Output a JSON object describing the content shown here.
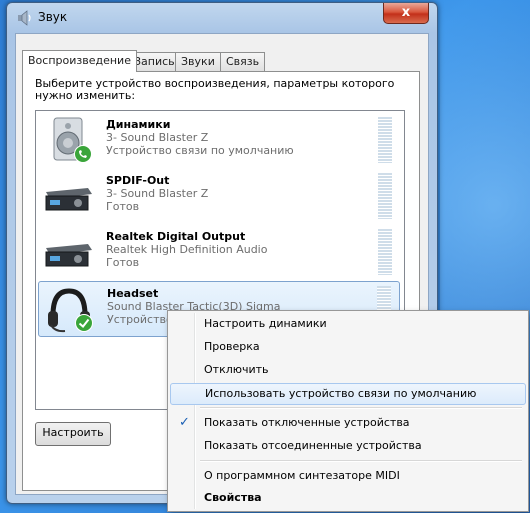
{
  "window": {
    "title": "Звук",
    "close_glyph": "x"
  },
  "tabs": [
    {
      "label": "Воспроизведение",
      "active": true
    },
    {
      "label": "Запись"
    },
    {
      "label": "Звуки"
    },
    {
      "label": "Связь"
    }
  ],
  "instruction": "Выберите устройство воспроизведения, параметры которого нужно изменить:",
  "devices": [
    {
      "name": "Динамики",
      "line2": "3- Sound Blaster Z",
      "line3": "Устройство связи по умолчанию",
      "icon": "speaker-icon",
      "badge": "phone-badge-icon"
    },
    {
      "name": "SPDIF-Out",
      "line2": "3- Sound Blaster Z",
      "line3": "Готов",
      "icon": "receiver-icon"
    },
    {
      "name": "Realtek Digital Output",
      "line2": "Realtek High Definition Audio",
      "line3": "Готов",
      "icon": "receiver-icon"
    },
    {
      "name": "Headset",
      "line2": "Sound Blaster Tactic(3D) Sigma",
      "line3": "Устройство",
      "icon": "headset-icon",
      "badge": "check-badge-icon",
      "selected": true
    }
  ],
  "config_button": "Настроить",
  "context_menu": {
    "items": [
      {
        "label": "Настроить динамики"
      },
      {
        "label": "Проверка"
      },
      {
        "label": "Отключить"
      },
      {
        "label": "Использовать устройство связи по умолчанию",
        "hover": true
      },
      {
        "label": "Показать отключенные устройства",
        "checked": true
      },
      {
        "label": "Показать отсоединенные устройства"
      },
      {
        "label": "О программном синтезаторе MIDI"
      },
      {
        "label": "Свойства",
        "bold": true
      }
    ]
  },
  "colors": {
    "accent": "#1a5fb4",
    "close": "#c3301a"
  }
}
